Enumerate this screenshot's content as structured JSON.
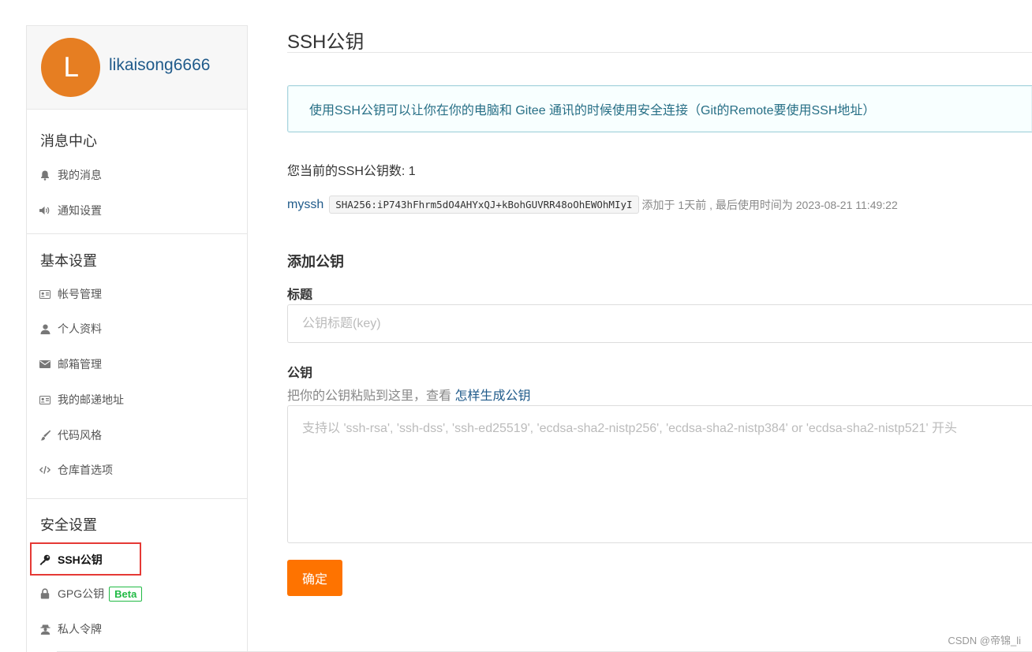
{
  "profile": {
    "avatar_letter": "L",
    "username": "likaisong6666",
    "avatar_color": "#e67e22"
  },
  "sidebar": {
    "sections": [
      {
        "title": "消息中心",
        "items": [
          {
            "label": "我的消息",
            "icon": "bell-icon"
          },
          {
            "label": "通知设置",
            "icon": "volume-icon"
          }
        ]
      },
      {
        "title": "基本设置",
        "items": [
          {
            "label": "帐号管理",
            "icon": "id-card-icon"
          },
          {
            "label": "个人资料",
            "icon": "user-icon"
          },
          {
            "label": "邮箱管理",
            "icon": "envelope-icon"
          },
          {
            "label": "我的邮递地址",
            "icon": "address-card-icon"
          },
          {
            "label": "代码风格",
            "icon": "paint-brush-icon"
          },
          {
            "label": "仓库首选项",
            "icon": "code-icon"
          }
        ]
      },
      {
        "title": "安全设置",
        "items": [
          {
            "label": "SSH公钥",
            "icon": "key-icon",
            "active": true
          },
          {
            "label": "GPG公钥",
            "icon": "lock-icon",
            "badge": "Beta"
          },
          {
            "label": "私人令牌",
            "icon": "user-secret-icon"
          }
        ]
      }
    ]
  },
  "main": {
    "title": "SSH公钥",
    "info": "使用SSH公钥可以让你在你的电脑和 Gitee 通讯的时候使用安全连接（Git的Remote要使用SSH地址）",
    "count_text": "您当前的SSH公钥数: 1",
    "key": {
      "name": "myssh",
      "fingerprint": "SHA256:iP743hFhrm5dO4AHYxQJ+kBohGUVRR48oOhEWOhMIyI",
      "meta": "添加于 1天前 , 最后使用时间为 2023-08-21 11:49:22"
    },
    "add_title": "添加公钥",
    "title_label": "标题",
    "title_placeholder": "公钥标题(key)",
    "key_label": "公钥",
    "hint_text": "把你的公钥粘贴到这里，查看 ",
    "hint_link": "怎样生成公钥",
    "key_placeholder": "支持以 'ssh-rsa', 'ssh-dss', 'ssh-ed25519', 'ecdsa-sha2-nistp256', 'ecdsa-sha2-nistp384' or 'ecdsa-sha2-nistp521' 开头",
    "submit_label": "确定"
  },
  "colors": {
    "accent": "#fe7300",
    "link": "#1f5a8a",
    "info_text": "#276f86",
    "beta": "#21ba45",
    "highlight_box": "#e53935"
  },
  "watermark": "CSDN @帝锦_li"
}
